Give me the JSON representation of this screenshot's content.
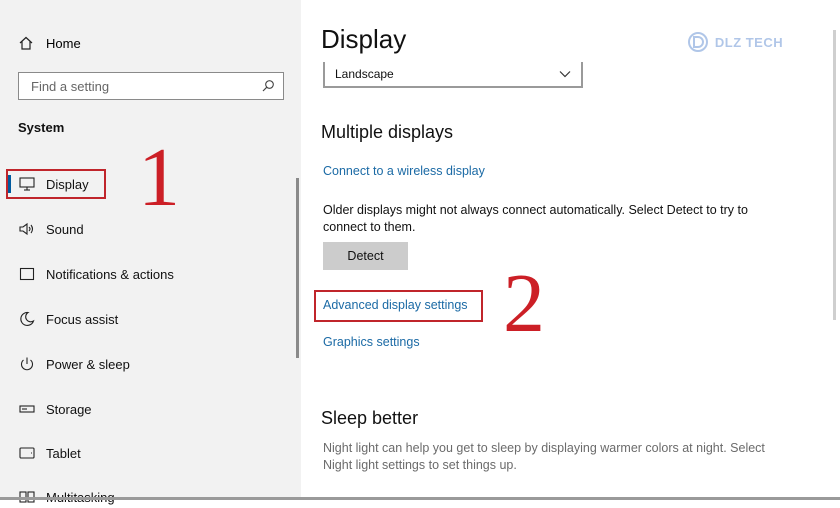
{
  "sidebar": {
    "home_label": "Home",
    "search_placeholder": "Find a setting",
    "section_title": "System",
    "items": [
      {
        "label": "Display",
        "icon": "monitor-icon"
      },
      {
        "label": "Sound",
        "icon": "speaker-icon"
      },
      {
        "label": "Notifications & actions",
        "icon": "notification-icon"
      },
      {
        "label": "Focus assist",
        "icon": "moon-icon"
      },
      {
        "label": "Power & sleep",
        "icon": "power-icon"
      },
      {
        "label": "Storage",
        "icon": "storage-icon"
      },
      {
        "label": "Tablet",
        "icon": "tablet-icon"
      },
      {
        "label": "Multitasking",
        "icon": "multitasking-icon"
      }
    ]
  },
  "annotations": {
    "step1": "1",
    "step2": "2"
  },
  "main": {
    "title": "Display",
    "orientation_value": "Landscape",
    "multiple_displays_heading": "Multiple displays",
    "wireless_link": "Connect to a wireless display",
    "older_displays_text": "Older displays might not always connect automatically. Select Detect to try to connect to them.",
    "detect_button": "Detect",
    "advanced_link": "Advanced display settings",
    "graphics_link": "Graphics settings",
    "sleep_heading": "Sleep better",
    "night_light_text": "Night light can help you get to sleep by displaying warmer colors at night. Select Night light settings to set things up."
  },
  "watermark": {
    "text": "DLZ TECH"
  },
  "colors": {
    "accent": "#1b6aa5",
    "highlight_red": "#c0252b",
    "sidebar_bg": "#f2f2f2"
  }
}
